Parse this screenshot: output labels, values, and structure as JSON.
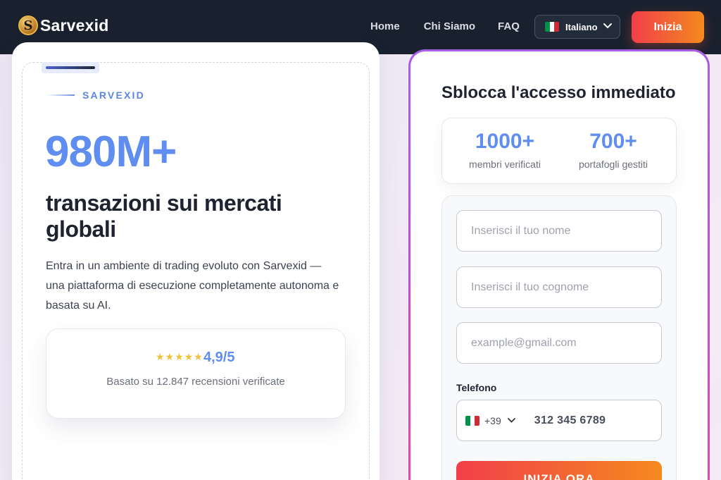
{
  "nav": {
    "brand": "Sarvexid",
    "logo_letter": "S",
    "links": [
      "Home",
      "Chi Siamo",
      "FAQ"
    ],
    "language": "Italiano",
    "cta": "Inizia"
  },
  "hero": {
    "eyebrow": "SARVEXID",
    "stat": "980M+",
    "headline": "transazioni sui mercati globali",
    "description": "Entra in un ambiente di trading evoluto con Sarvexid — una piattaforma di esecuzione completamente autonoma e basata su AI.",
    "rating": {
      "stars": "★★★★★",
      "score": "4,9/5",
      "based_on": "Basato su 12.847 recensioni verificate"
    }
  },
  "form": {
    "title": "Sblocca l'accesso immediato",
    "stats": [
      {
        "value": "1000+",
        "label": "membri verificati"
      },
      {
        "value": "700+",
        "label": "portafogli gestiti"
      }
    ],
    "first_name_placeholder": "Inserisci il tuo nome",
    "last_name_placeholder": "Inserisci il tuo cognome",
    "email_placeholder": "example@gmail.com",
    "phone_label": "Telefono",
    "country_code": "+39",
    "phone_value": "312 345 6789",
    "submit": "INIZIA ORA"
  },
  "colors": {
    "nav_bg": "#19212e",
    "accent_blue": "#5f8ef0",
    "cta_gradient_start": "#f23f4a",
    "cta_gradient_end": "#f68a1f",
    "flag_green": "#009246",
    "flag_white": "#ffffff",
    "flag_red": "#ce2b37"
  }
}
